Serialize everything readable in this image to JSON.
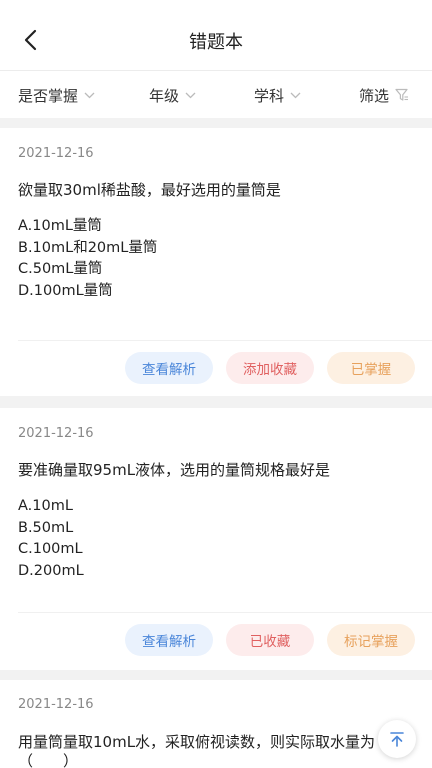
{
  "header": {
    "title": "错题本"
  },
  "filters": [
    "是否掌握",
    "年级",
    "学科",
    "筛选"
  ],
  "cards": [
    {
      "date": "2021-12-16",
      "question": "欲量取30ml稀盐酸，最好选用的量筒是",
      "options": [
        "A.10mL量筒",
        "B.10mL和20mL量筒",
        "C.50mL量筒",
        "D.100mL量筒"
      ],
      "buttons": [
        "查看解析",
        "添加收藏",
        "已掌握"
      ]
    },
    {
      "date": "2021-12-16",
      "question": "要准确量取95mL液体，选用的量筒规格最好是",
      "options": [
        "A.10mL",
        "B.50mL",
        "C.100mL",
        "D.200mL"
      ],
      "buttons": [
        "查看解析",
        "已收藏",
        "标记掌握"
      ]
    },
    {
      "date": "2021-12-16",
      "question": "用量筒量取10mL水，采取俯视读数，则实际取水量为",
      "question_line2": "（　　）"
    }
  ],
  "colors": {
    "blue": "#4a86d9",
    "red": "#e06060",
    "orange": "#e7a15c"
  }
}
